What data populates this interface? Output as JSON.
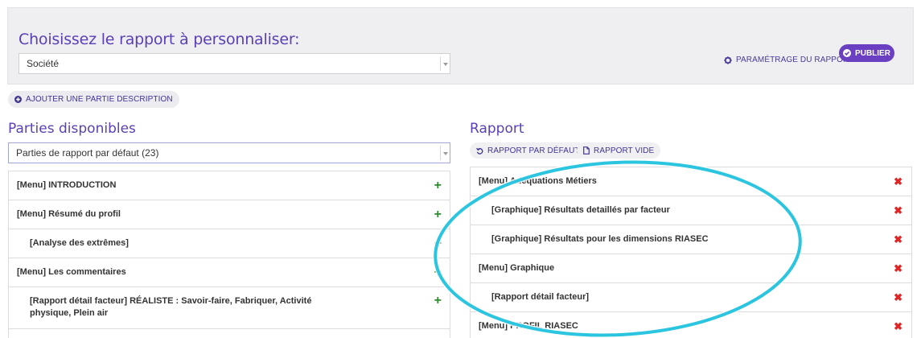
{
  "header": {
    "title": "Choisissez le rapport à personnaliser:",
    "report_select_value": "Société",
    "settings_label": "PARAMÉTRAGE DU RAPPORT",
    "publish_label": "PUBLIER"
  },
  "add_description_label": "AJOUTER UNE PARTIE DESCRIPTION",
  "available": {
    "title": "Parties disponibles",
    "select_value": "Parties de rapport par défaut (23)",
    "items": [
      {
        "label": "[Menu] INTRODUCTION"
      },
      {
        "label": "[Menu] Résumé du profil"
      },
      {
        "label": "[Analyse des extrêmes]"
      },
      {
        "label": "[Menu] Les commentaires"
      },
      {
        "label": "[Rapport détail facteur] RÉALISTE : Savoir-faire, Fabriquer, Activité physique, Plein air"
      }
    ]
  },
  "report": {
    "title": "Rapport",
    "default_report_label": "RAPPORT PAR DÉFAUT",
    "empty_report_label": "RAPPORT VIDE",
    "items": [
      {
        "label": "[Menu] Adéquations Métiers"
      },
      {
        "label": "[Graphique] Résultats detaillés par facteur"
      },
      {
        "label": "[Graphique] Résultats pour les dimensions RIASEC"
      },
      {
        "label": "[Menu] Graphique"
      },
      {
        "label": "[Rapport détail facteur]"
      },
      {
        "label": "[Menu] PROFIL RIASEC"
      }
    ]
  },
  "colors": {
    "accent": "#5a3fb7",
    "publish_bg": "#6a3fc2",
    "add_green": "#2b8a2b",
    "remove_red": "#e02525",
    "highlight": "#2cc5e0"
  }
}
